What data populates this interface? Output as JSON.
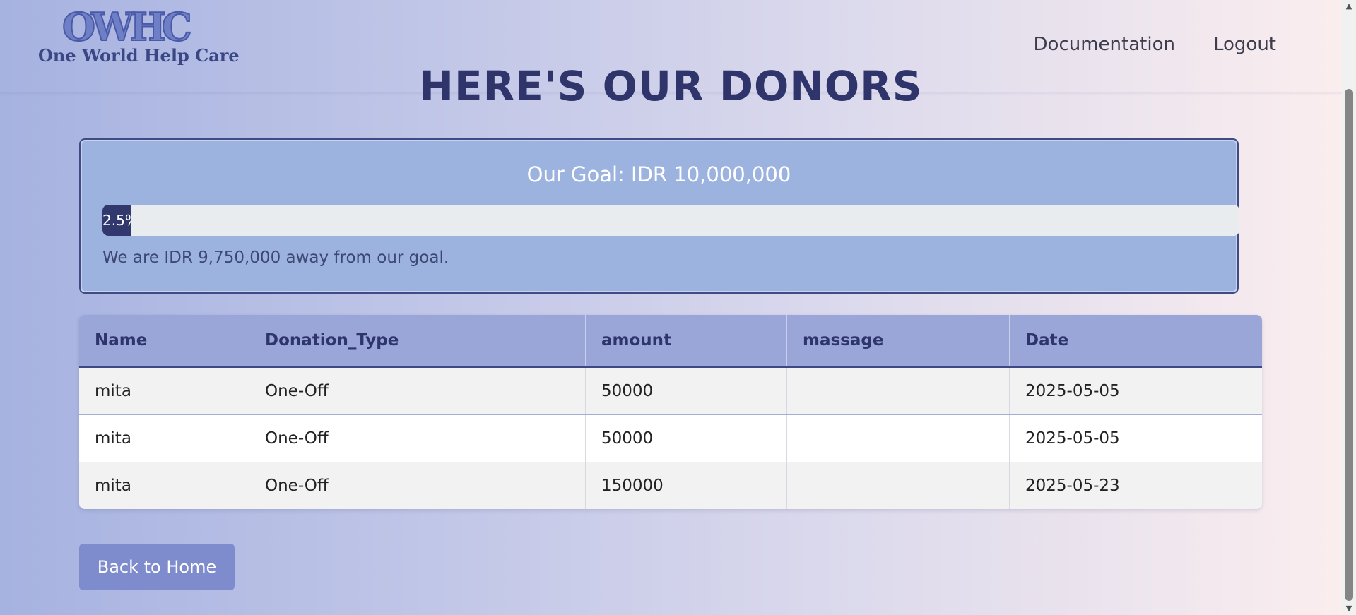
{
  "header": {
    "logo_mark": "OWHC",
    "logo_text": "One World Help Care",
    "nav": [
      {
        "label": "Documentation"
      },
      {
        "label": "Logout"
      }
    ]
  },
  "page_title": "HERE'S OUR DONORS",
  "goal": {
    "title": "Our Goal: IDR 10,000,000",
    "progress_label": "2.5%",
    "progress_fraction": 0.025,
    "remaining_text": "We are IDR 9,750,000 away from our goal."
  },
  "table": {
    "columns": [
      "Name",
      "Donation_Type",
      "amount",
      "massage",
      "Date"
    ],
    "rows": [
      [
        "mita",
        "One-Off",
        "50000",
        "",
        "2025-05-05"
      ],
      [
        "mita",
        "One-Off",
        "50000",
        "",
        "2025-05-05"
      ],
      [
        "mita",
        "One-Off",
        "150000",
        "",
        "2025-05-23"
      ]
    ]
  },
  "back_button": "Back to Home",
  "colors": {
    "title": "#2f356b",
    "card_bg": "#9db3df",
    "progress_fill": "#30386e",
    "header_row": "#9aa6d8",
    "button": "#7e8bcc"
  }
}
